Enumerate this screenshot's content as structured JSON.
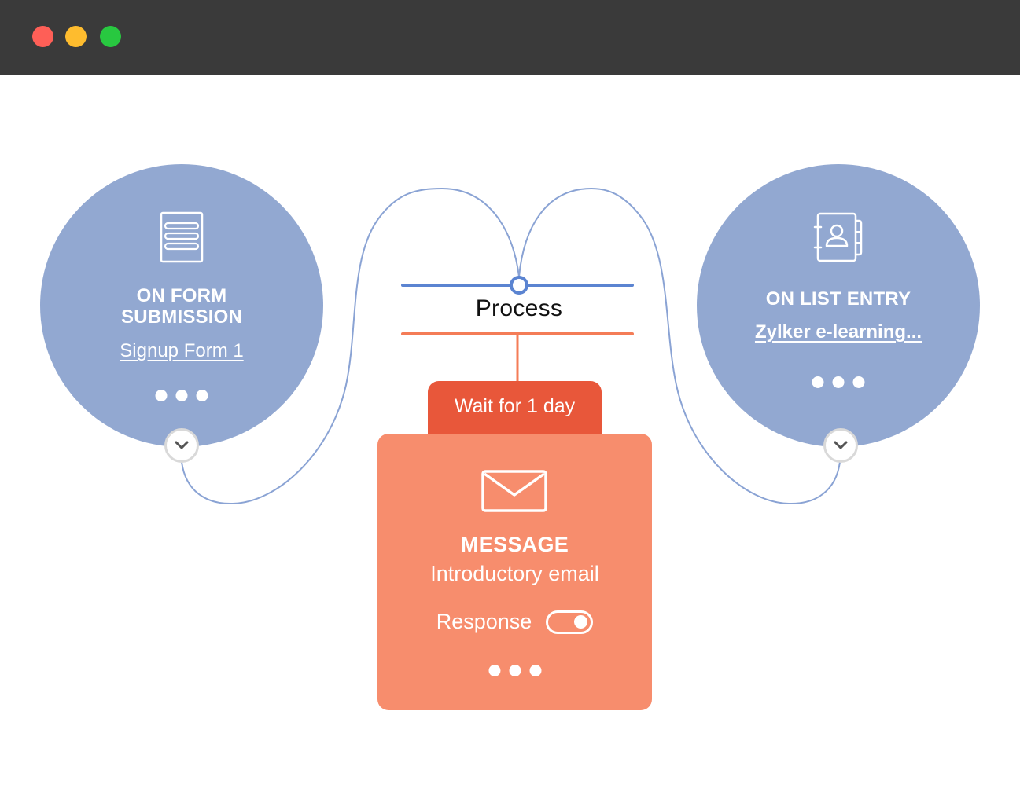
{
  "window": {
    "controls": [
      {
        "name": "close",
        "color": "#fe5f57"
      },
      {
        "name": "minimize",
        "color": "#febc2e"
      },
      {
        "name": "maximize",
        "color": "#28c840"
      }
    ]
  },
  "colors": {
    "trigger_fill": "#92a8d1",
    "connector_blue": "#8aa3d4",
    "process_blue": "#5b84d1",
    "process_orange": "#f47c57",
    "wait_tab": "#e8573a",
    "message_card": "#f78d6d"
  },
  "triggers": [
    {
      "icon": "form-icon",
      "title_line1": "ON FORM",
      "title_line2": "SUBMISSION",
      "link": "Signup Form 1",
      "more_icon": "more-dots-icon",
      "expand_icon": "chevron-down-icon"
    },
    {
      "icon": "contact-book-icon",
      "title_line1": "ON LIST ENTRY",
      "link": "Zylker e-learning...",
      "more_icon": "more-dots-icon",
      "expand_icon": "chevron-down-icon"
    }
  ],
  "process": {
    "label": "Process"
  },
  "wait": {
    "label": "Wait for 1 day"
  },
  "message": {
    "icon": "envelope-icon",
    "title": "MESSAGE",
    "name": "Introductory email",
    "response_label": "Response",
    "response_enabled": true
  }
}
